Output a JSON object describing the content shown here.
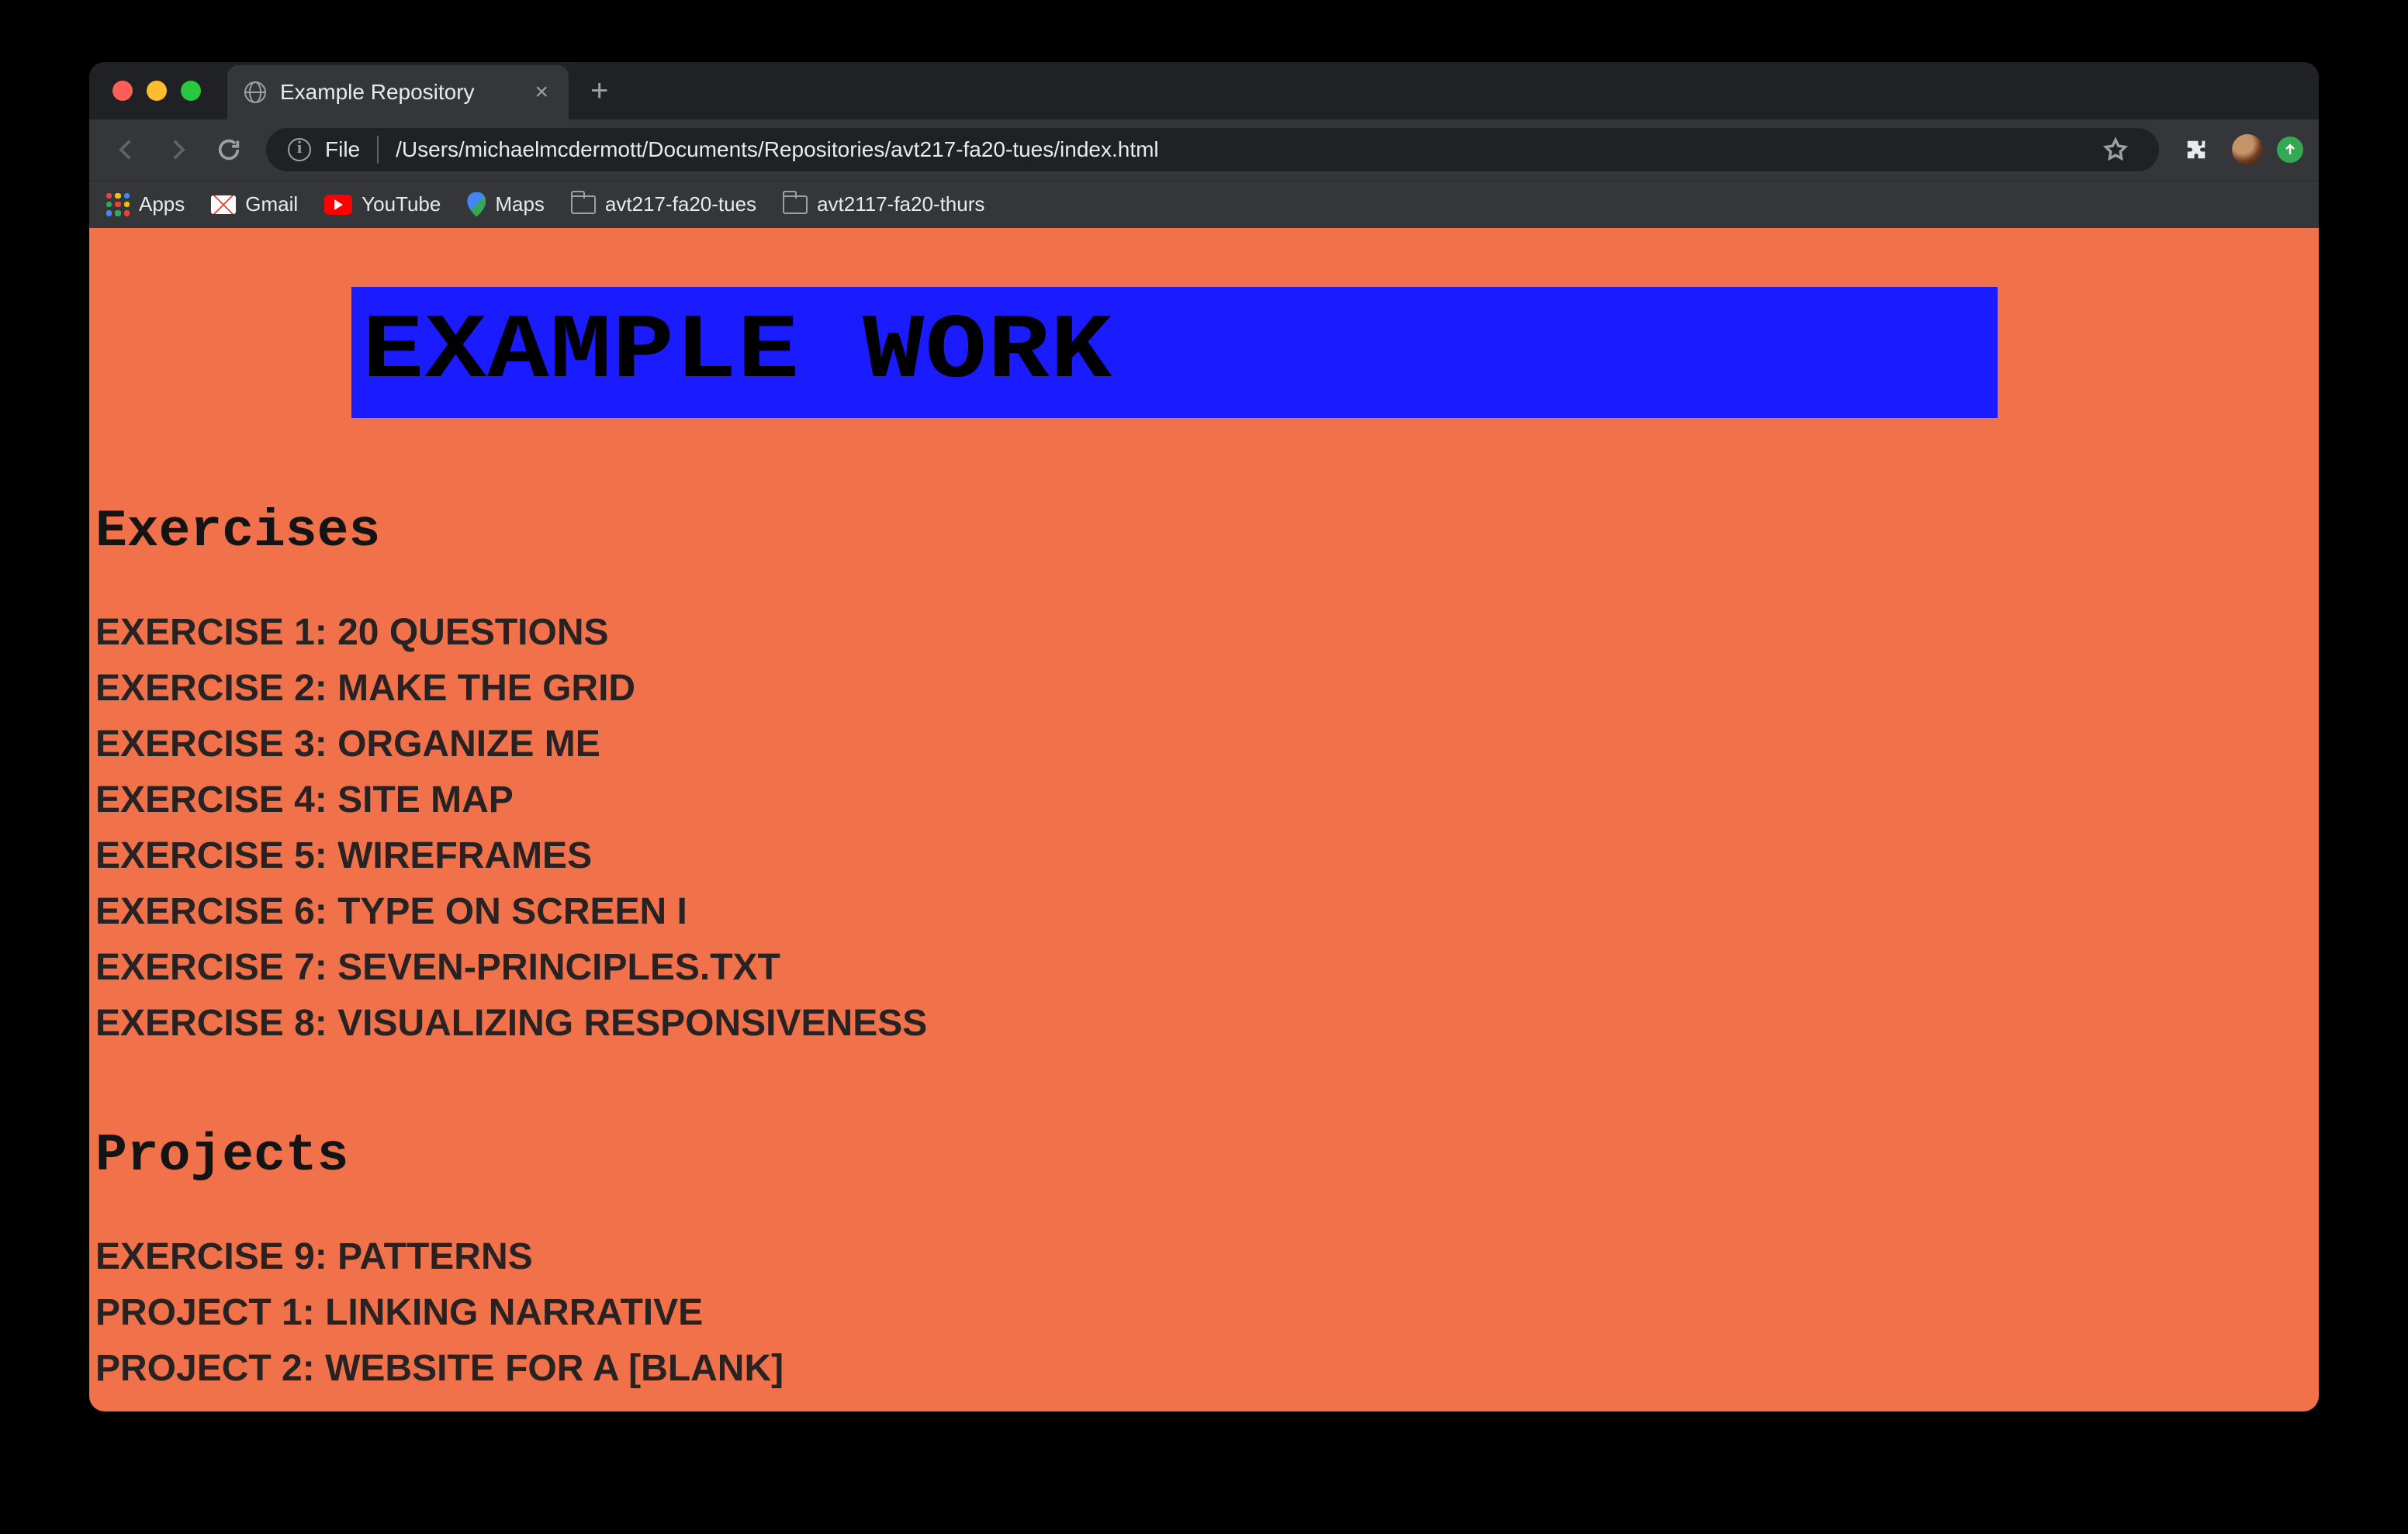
{
  "window": {
    "tab_title": "Example Repository"
  },
  "address_bar": {
    "scheme": "File",
    "path": "/Users/michaelmcdermott/Documents/Repositories/avt217-fa20-tues/index.html"
  },
  "bookmarks": {
    "apps": "Apps",
    "items": [
      {
        "label": "Gmail"
      },
      {
        "label": "YouTube"
      },
      {
        "label": "Maps"
      },
      {
        "label": "avt217-fa20-tues"
      },
      {
        "label": "avt2117-fa20-thurs"
      }
    ]
  },
  "page": {
    "title": "EXAMPLE WORK",
    "sections": [
      {
        "heading": "Exercises",
        "links": [
          "EXERCISE 1: 20 QUESTIONS",
          "EXERCISE 2: MAKE THE GRID",
          "EXERCISE 3: ORGANIZE ME",
          "EXERCISE 4: SITE MAP",
          "EXERCISE 5: WIREFRAMES",
          "EXERCISE 6: TYPE ON SCREEN I",
          "EXERCISE 7: SEVEN-PRINCIPLES.TXT",
          "EXERCISE 8: VISUALIZING RESPONSIVENESS"
        ]
      },
      {
        "heading": "Projects",
        "links": [
          "EXERCISE 9: PATTERNS",
          "PROJECT 1: LINKING NARRATIVE",
          "PROJECT 2: WEBSITE FOR A [BLANK]"
        ]
      }
    ]
  }
}
